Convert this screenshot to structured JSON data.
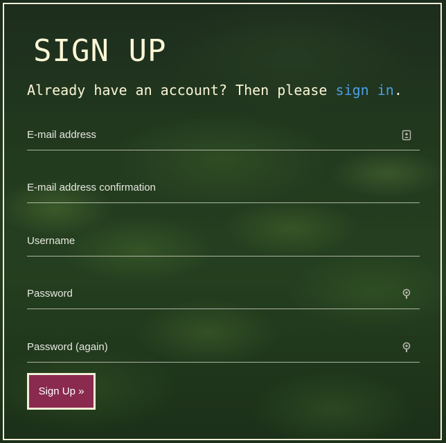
{
  "form": {
    "title": "SIGN UP",
    "subtitle_prefix": "Already have an account? Then please ",
    "subtitle_link": "sign in",
    "subtitle_suffix": ".",
    "fields": [
      {
        "label": "E-mail address",
        "icon": "contact-card-icon"
      },
      {
        "label": "E-mail address confirmation"
      },
      {
        "label": "Username"
      },
      {
        "label": "Password",
        "icon": "key-icon"
      },
      {
        "label": "Password (again)",
        "icon": "key-icon"
      }
    ],
    "submit_label": "Sign Up »"
  },
  "colors": {
    "accent_link": "#4a9fe8",
    "button_bg": "#8a2a4f",
    "frame_border": "#f2eed8",
    "title_text": "#fbf6d6"
  }
}
